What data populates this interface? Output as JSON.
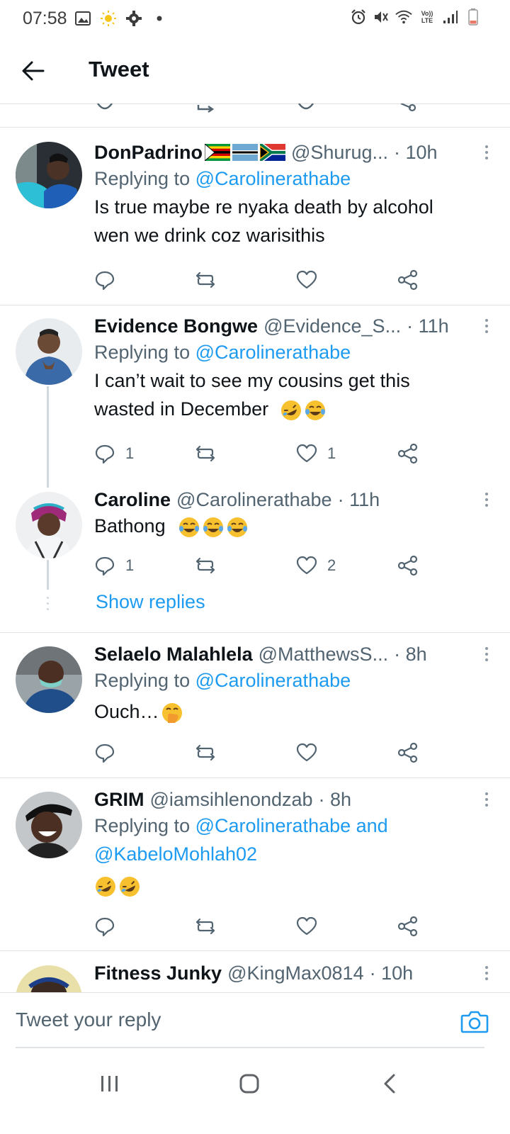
{
  "status_bar": {
    "time": "07:58",
    "left_icons": [
      "image-icon",
      "sun-icon",
      "gear-icon",
      "dot-icon"
    ],
    "right_icons": [
      "alarm-icon",
      "mute-icon",
      "wifi-icon",
      "volte-icon",
      "signal-icon",
      "battery-icon"
    ],
    "volte_top": "Vo))",
    "volte_bottom": "LTE"
  },
  "app_bar": {
    "back_icon": "arrow-left-icon",
    "title": "Tweet"
  },
  "tweets": [
    {
      "name": "DonPadrino",
      "flags": [
        "zimbabwe",
        "botswana",
        "south-africa"
      ],
      "handle": "@Shurug...",
      "time": "· 10h",
      "replying_prefix": "Replying to ",
      "replying_to": "@Carolinerathabe",
      "text_line1": "Is true maybe re nyaka  death by alcohol",
      "text_line2": "wen we drink coz warisithis",
      "reply_count": "",
      "like_count": ""
    },
    {
      "name": "Evidence Bongwe",
      "handle": "@Evidence_S...",
      "time": "· 11h",
      "replying_prefix": "Replying to ",
      "replying_to": "@Carolinerathabe",
      "text_line1": "I can’t wait to see my cousins get this",
      "text_line2": "wasted in December",
      "emojis": [
        "rolling-laughing",
        "tears-of-joy"
      ],
      "reply_count": "1",
      "like_count": "1"
    },
    {
      "name": "Caroline",
      "handle": "@Carolinerathabe",
      "time": "· 11h",
      "text": "Bathong",
      "emojis": [
        "tears-of-joy",
        "tears-of-joy",
        "tears-of-joy"
      ],
      "reply_count": "1",
      "like_count": "2",
      "show_replies": "Show replies"
    },
    {
      "name": "Selaelo Malahlela",
      "handle": "@MatthewsS...",
      "time": "· 8h",
      "replying_prefix": "Replying to ",
      "replying_to": "@Carolinerathabe",
      "text": "Ouch…",
      "emojis": [
        "hand-over-mouth"
      ],
      "reply_count": "",
      "like_count": ""
    },
    {
      "name": "GRIM",
      "handle": "@iamsihlenondzab",
      "time": "· 8h",
      "replying_prefix": "Replying to ",
      "replying_to": "@Carolinerathabe and",
      "replying_to_line2": "@KabeloMohlah02",
      "emojis": [
        "rolling-laughing",
        "rolling-laughing"
      ],
      "reply_count": "",
      "like_count": ""
    },
    {
      "name": "Fitness Junky",
      "handle": "@KingMax0814",
      "time": "· 10h"
    }
  ],
  "reply_bar": {
    "placeholder": "Tweet your reply",
    "camera_icon": "camera-icon"
  },
  "nav_bar": {
    "icons": [
      "recent-apps-icon",
      "home-icon",
      "back-icon"
    ]
  },
  "colors": {
    "accent": "#1d9bf0",
    "text": "#0f1419",
    "secondary": "#536471",
    "divider": "#dfe3e6",
    "emoji": "#f7c02e"
  }
}
